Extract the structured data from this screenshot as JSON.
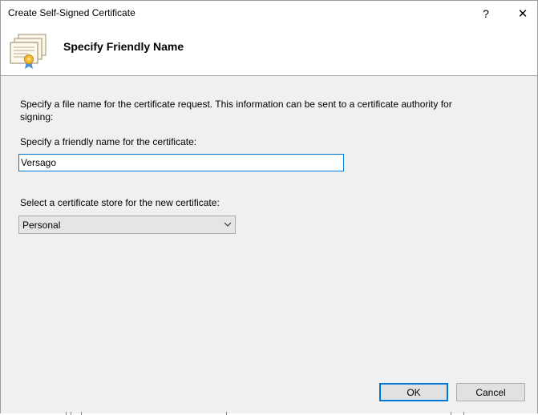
{
  "window": {
    "title": "Create Self-Signed Certificate",
    "help_label": "?",
    "close_label": "✕"
  },
  "header": {
    "title": "Specify Friendly Name",
    "icon": "certificate-icon"
  },
  "body": {
    "description": "Specify a file name for the certificate request.  This information can be sent to a certificate authority for signing:",
    "friendly_name_label": "Specify a friendly name for the certificate:",
    "friendly_name_value": "Versago",
    "store_label": "Select a certificate store for the new certificate:",
    "store_value": "Personal"
  },
  "buttons": {
    "ok": "OK",
    "cancel": "Cancel"
  },
  "colors": {
    "accent": "#0078d7",
    "dialog_bg": "#f0f0f0",
    "header_bg": "#ffffff"
  }
}
